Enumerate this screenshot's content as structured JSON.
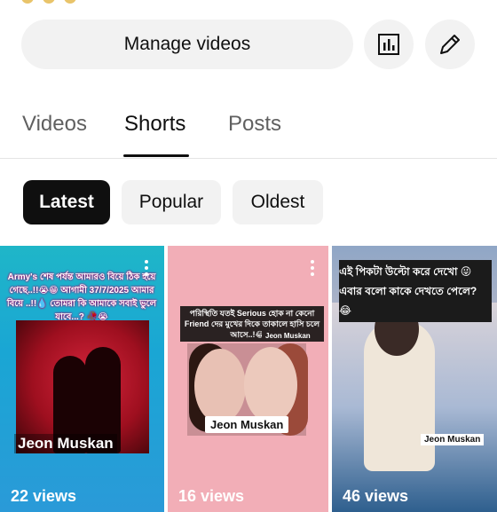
{
  "header": {
    "manage_videos_label": "Manage videos",
    "analytics_icon": "bar-chart-icon",
    "edit_icon": "pencil-icon"
  },
  "tabs": [
    {
      "label": "Videos",
      "active": false
    },
    {
      "label": "Shorts",
      "active": true
    },
    {
      "label": "Posts",
      "active": false
    }
  ],
  "chips": [
    {
      "label": "Latest",
      "active": true
    },
    {
      "label": "Popular",
      "active": false
    },
    {
      "label": "Oldest",
      "active": false
    }
  ],
  "shorts": [
    {
      "caption": "Army's শেষ পর্যন্ত আমারও বিয়ে ঠিক হয়ে গেছে..!!😭😁 আগামী 37/7/2025 আমার বিয়ে ..!!💧 তোমরা কি আমাকে সবাই ভুলে যাবে...? 🥀😭",
      "watermark": "Jeon Muskan",
      "views": "22 views"
    },
    {
      "caption": "পরিস্থিতি যতই Serious হোক না কেনো Friend দের মুখের দিকে তাকালে হাসি চলে আসে..!😂😂",
      "watermark": "Jeon Muskan",
      "watermark_small": "Jeon Muskan",
      "views": "16 views"
    },
    {
      "caption_line1": "এই পিকটা উল্টো করে দেখো 😜",
      "caption_line2": "এবার বলো কাকে দেখতে পেলে? 😂",
      "watermark": "Jeon Muskan",
      "views": "46 views"
    }
  ],
  "colors": {
    "chip_active_bg": "#0f0f0f",
    "chip_bg": "#f2f2f2",
    "tab_inactive": "#606060"
  }
}
